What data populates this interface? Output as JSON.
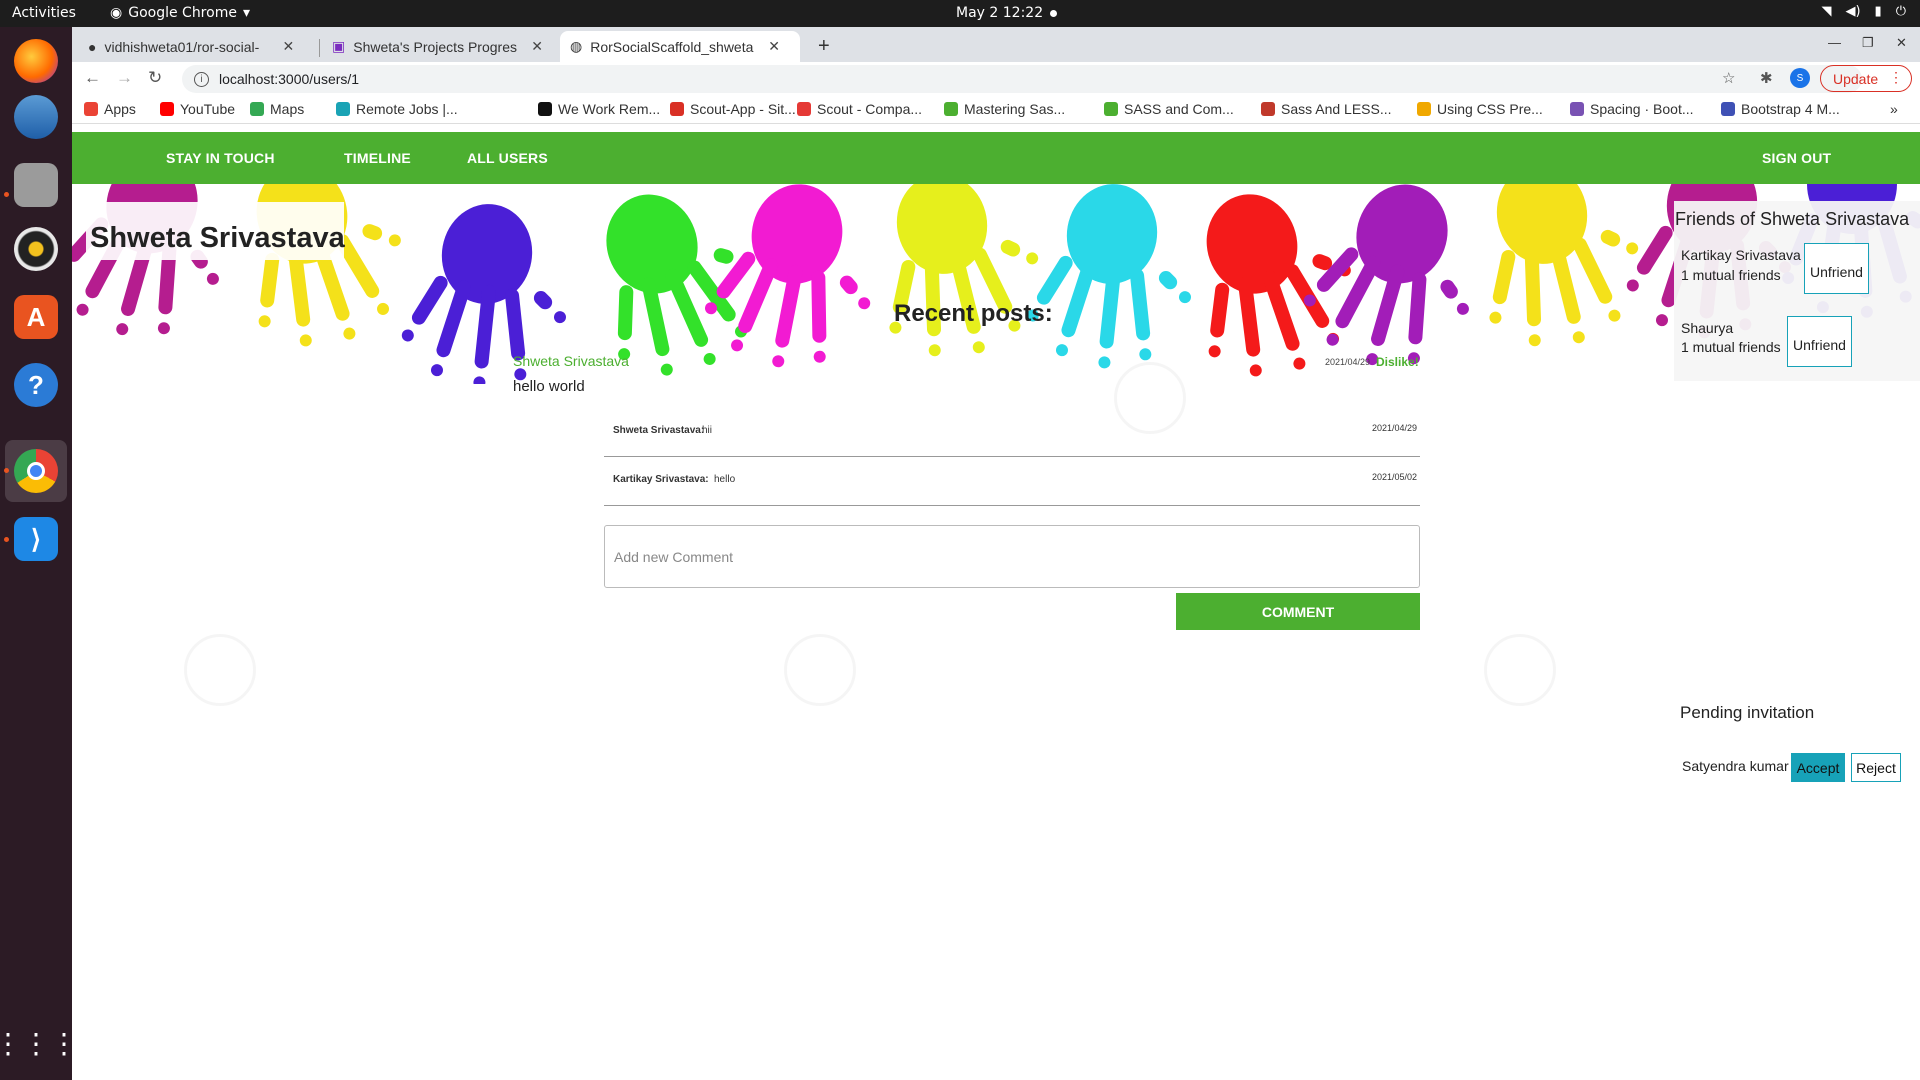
{
  "os": {
    "activities": "Activities",
    "app_name": "Google Chrome",
    "clock": "May 2  12:22"
  },
  "browser": {
    "tabs": [
      {
        "title": "vidhishweta01/ror-social-"
      },
      {
        "title": "Shweta's Projects Progres"
      },
      {
        "title": "RorSocialScaffold_shweta"
      }
    ],
    "url": "localhost:3000/users/1",
    "profile_initial": "S",
    "update_label": "Update",
    "bookmarks": [
      {
        "label": "Apps",
        "color": "#ea4335"
      },
      {
        "label": "YouTube",
        "color": "#ff0000"
      },
      {
        "label": "Maps",
        "color": "#34a853"
      },
      {
        "label": "Remote Jobs |...",
        "color": "#1aa3b5"
      },
      {
        "label": "We Work Rem...",
        "color": "#111111"
      },
      {
        "label": "Scout-App - Sit...",
        "color": "#d93025"
      },
      {
        "label": "Scout - Compa...",
        "color": "#e53935"
      },
      {
        "label": "Mastering Sas...",
        "color": "#4caf30"
      },
      {
        "label": "SASS and Com...",
        "color": "#4caf30"
      },
      {
        "label": "Sass And LESS...",
        "color": "#c0392b"
      },
      {
        "label": "Using CSS Pre...",
        "color": "#f0a800"
      },
      {
        "label": "Spacing · Boot...",
        "color": "#7952b3"
      },
      {
        "label": "Bootstrap 4 M...",
        "color": "#3f51b5"
      }
    ]
  },
  "nav": {
    "stay_in_touch": "STAY IN TOUCH",
    "timeline": "TIMELINE",
    "all_users": "ALL USERS",
    "sign_out": "SIGN OUT"
  },
  "profile": {
    "name": "Shweta Srivastava"
  },
  "posts": {
    "title": "Recent posts:",
    "items": [
      {
        "author": "Shweta Srivastava",
        "body": "hello world",
        "date": "2021/04/29",
        "like_action": "Dislike!",
        "comments": [
          {
            "author": "Shweta Srivastava:",
            "text": "hii",
            "date": "2021/04/29"
          },
          {
            "author": "Kartikay Srivastava:",
            "text": "hello",
            "date": "2021/05/02"
          }
        ]
      }
    ],
    "comment_placeholder": "Add new Comment",
    "comment_button": "COMMENT"
  },
  "friends": {
    "title": "Friends of Shweta Srivastava",
    "items": [
      {
        "name": "Kartikay Srivastava",
        "mutual": "1 mutual friends",
        "action": "Unfriend"
      },
      {
        "name": "Shaurya",
        "mutual": "1 mutual friends",
        "action": "Unfriend"
      }
    ]
  },
  "pending": {
    "title": "Pending invitation",
    "items": [
      {
        "name": "Satyendra kumar",
        "accept": "Accept",
        "reject": "Reject"
      }
    ]
  },
  "colors": {
    "brand_green": "#4caf30",
    "info_teal": "#17a2b8"
  }
}
